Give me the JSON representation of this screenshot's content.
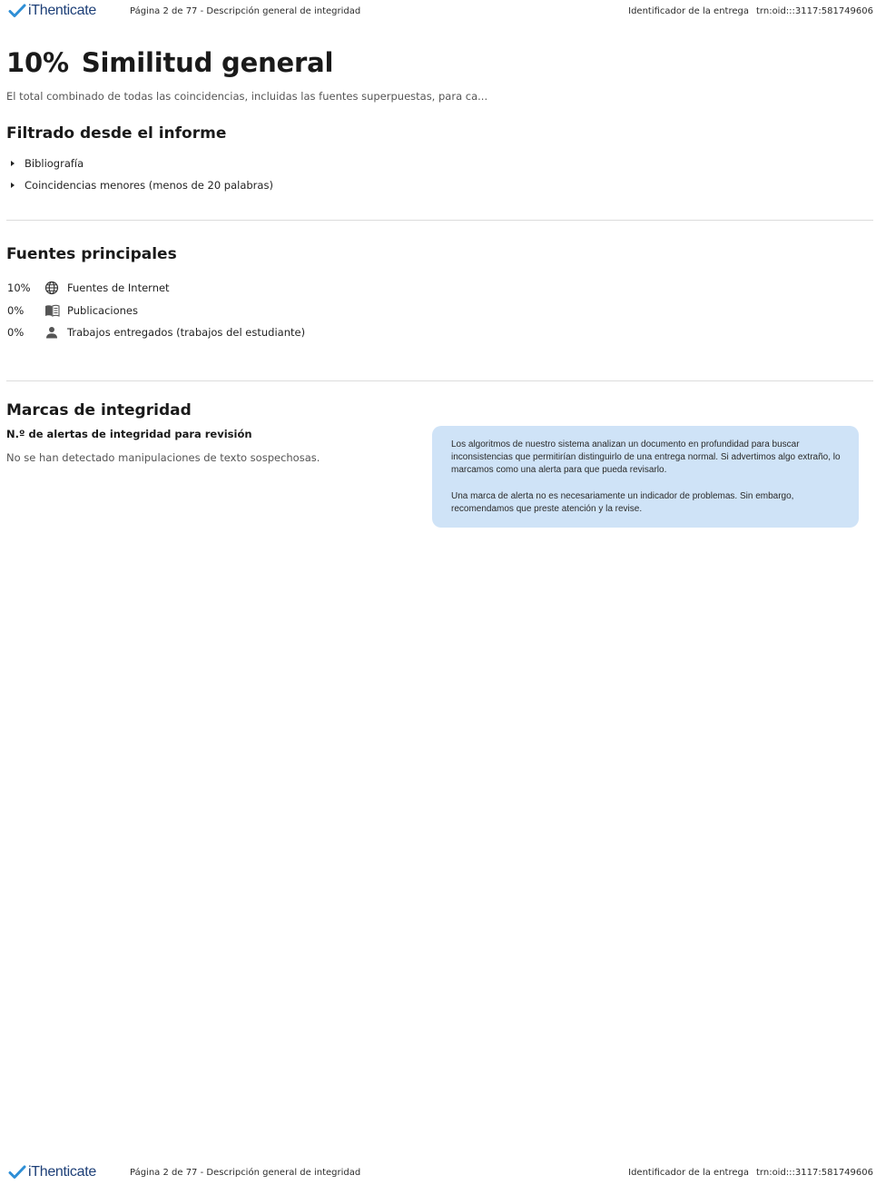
{
  "header": {
    "logo_text": "iThenticate",
    "page_info": "Página 2 de 77 - Descripción general de integridad",
    "id_label": "Identificador de la entrega",
    "id_value": "trn:oid:::3117:581749606"
  },
  "similarity": {
    "percent": "10%",
    "title": "Similitud general",
    "description": "El total combinado de todas las coincidencias, incluidas las fuentes superpuestas, para ca..."
  },
  "filtered": {
    "heading": "Filtrado desde el informe",
    "items": [
      "Bibliografía",
      "Coincidencias menores (menos de 20 palabras)"
    ]
  },
  "sources": {
    "heading": "Fuentes principales",
    "rows": [
      {
        "percent": "10%",
        "icon": "globe-icon",
        "label": "Fuentes de Internet"
      },
      {
        "percent": "0%",
        "icon": "book-icon",
        "label": "Publicaciones"
      },
      {
        "percent": "0%",
        "icon": "person-icon",
        "label": "Trabajos entregados (trabajos del estudiante)"
      }
    ]
  },
  "integrity": {
    "heading": "Marcas de integridad",
    "alerts_label": "N.º de alertas de integridad para revisión",
    "no_alerts_text": "No se han detectado manipulaciones de texto sospechosas.",
    "info_p1": "Los algoritmos de nuestro sistema analizan un documento en profundidad para buscar inconsistencias que permitirían distinguirlo de una entrega normal. Si advertimos algo extraño, lo marcamos como una alerta para que pueda revisarlo.",
    "info_p2": "Una marca de alerta no es necesariamente un indicador de problemas. Sin embargo, recomendamos que preste atención y la revise."
  },
  "footer": {
    "logo_text": "iThenticate",
    "page_info": "Página 2 de 77 - Descripción general de integridad",
    "id_label": "Identificador de la entrega",
    "id_value": "trn:oid:::3117:581749606"
  },
  "colors": {
    "brand": "#1d3f77",
    "check": "#2e8fd6",
    "info_box": "#cfe3f7"
  }
}
